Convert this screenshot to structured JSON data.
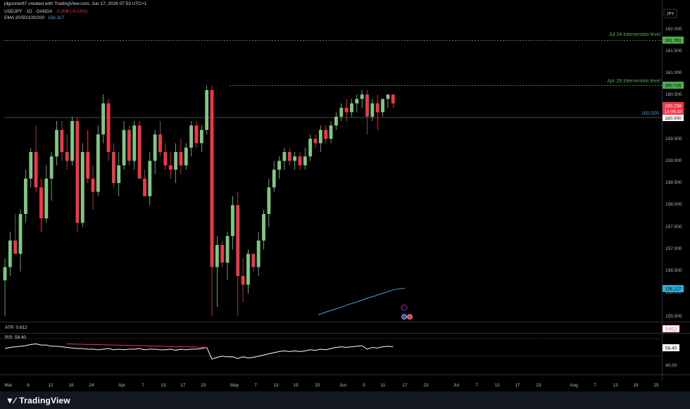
{
  "header": {
    "credit": "jdgunner87 created with TradingView.com, Jun 17, 2026 07:53 UTC+1",
    "symbol_line": "USDJPY · 1D · OANDA",
    "change": "-0.208 (-0.13%)",
    "ema_label": "EMA 20/50/100/200",
    "ema_value": "156.117"
  },
  "currency": "JPY",
  "price_axis": {
    "ticks": [
      "162.000",
      "161.500",
      "161.000",
      "160.500",
      "159.500",
      "159.000",
      "158.500",
      "158.000",
      "157.500",
      "157.000",
      "156.500",
      "156.000",
      "155.500"
    ]
  },
  "levels": {
    "jul24": {
      "label": "Jul 24 Intervention level",
      "value": "161.761"
    },
    "apr26": {
      "label": "Apr 26 Intervention level",
      "value": "160.726"
    },
    "round": {
      "label": "160.000",
      "value": "160.000"
    },
    "last": {
      "price": "160.258",
      "countdown": "14:06:33"
    },
    "ema_tag": "156.117"
  },
  "atr": {
    "label": "ATR",
    "value": "0.612",
    "tag": "0.612"
  },
  "rsi": {
    "label": "RSI",
    "value": "58.40",
    "tag": "58.40",
    "tick_low": "40.00"
  },
  "x_axis": {
    "labels": [
      "Mar",
      "6",
      "12",
      "18",
      "24",
      "Apr",
      "7",
      "13",
      "17",
      "23",
      "May",
      "7",
      "13",
      "19",
      "25",
      "Jun",
      "5",
      "11",
      "17",
      "23",
      "Jul",
      "7",
      "13",
      "17",
      "23",
      "Aug",
      "7",
      "13",
      "19",
      "25"
    ]
  },
  "footer": {
    "brand": "TradingView"
  },
  "colors": {
    "up": "#81c784",
    "down": "#f23645",
    "ema": "#2ab1d9",
    "level": "#4caf50"
  },
  "chart_data": {
    "type": "candlestick",
    "ylim": [
      155.35,
      162.3
    ],
    "candles": [
      [
        156.3,
        156.8,
        155.5,
        156.6
      ],
      [
        156.6,
        157.4,
        156.4,
        157.2
      ],
      [
        157.2,
        157.8,
        156.9,
        156.9
      ],
      [
        156.9,
        157.9,
        156.5,
        157.8
      ],
      [
        157.8,
        158.8,
        157.6,
        158.6
      ],
      [
        158.6,
        159.3,
        158.4,
        159.2
      ],
      [
        159.2,
        159.8,
        158.3,
        158.4
      ],
      [
        158.4,
        158.6,
        157.4,
        157.7
      ],
      [
        157.7,
        158.9,
        157.6,
        158.6
      ],
      [
        158.6,
        159.2,
        158.1,
        159.1
      ],
      [
        159.1,
        159.9,
        158.9,
        159.7
      ],
      [
        159.7,
        159.9,
        159.0,
        159.2
      ],
      [
        159.2,
        159.6,
        158.8,
        159.0
      ],
      [
        159.0,
        160.0,
        158.9,
        159.9
      ],
      [
        159.9,
        160.0,
        157.4,
        157.6
      ],
      [
        157.6,
        159.4,
        157.5,
        159.2
      ],
      [
        159.2,
        159.7,
        158.5,
        158.6
      ],
      [
        158.6,
        158.9,
        157.9,
        158.3
      ],
      [
        158.3,
        159.8,
        158.2,
        159.6
      ],
      [
        159.6,
        160.5,
        159.4,
        160.3
      ],
      [
        160.3,
        160.4,
        159.0,
        159.2
      ],
      [
        159.2,
        159.4,
        158.4,
        158.5
      ],
      [
        158.5,
        159.2,
        158.2,
        158.9
      ],
      [
        158.9,
        159.9,
        158.8,
        159.7
      ],
      [
        159.7,
        159.8,
        158.9,
        159.0
      ],
      [
        159.0,
        159.9,
        158.8,
        159.8
      ],
      [
        159.8,
        159.9,
        158.8,
        158.6
      ],
      [
        158.6,
        158.8,
        158.2,
        158.2
      ],
      [
        158.2,
        159.2,
        158.0,
        159.0
      ],
      [
        159.0,
        159.7,
        158.7,
        159.6
      ],
      [
        159.6,
        159.9,
        159.1,
        159.2
      ],
      [
        159.2,
        159.4,
        158.8,
        158.9
      ],
      [
        158.9,
        159.2,
        158.6,
        158.8
      ],
      [
        158.8,
        159.4,
        158.5,
        159.2
      ],
      [
        159.2,
        159.5,
        158.7,
        158.9
      ],
      [
        158.9,
        159.4,
        158.8,
        159.3
      ],
      [
        159.3,
        159.9,
        159.1,
        159.8
      ],
      [
        159.8,
        159.9,
        159.3,
        159.4
      ],
      [
        159.4,
        159.8,
        159.2,
        159.7
      ],
      [
        159.7,
        160.7,
        159.6,
        160.6
      ],
      [
        160.6,
        160.7,
        155.5,
        156.6
      ],
      [
        156.6,
        157.3,
        155.7,
        157.1
      ],
      [
        157.1,
        157.2,
        156.6,
        156.7
      ],
      [
        156.7,
        157.4,
        156.3,
        157.3
      ],
      [
        157.3,
        158.2,
        157.0,
        158.0
      ],
      [
        158.0,
        158.3,
        155.5,
        156.4
      ],
      [
        156.4,
        156.8,
        155.8,
        156.2
      ],
      [
        156.2,
        157.0,
        156.0,
        156.9
      ],
      [
        156.9,
        156.9,
        156.5,
        156.6
      ],
      [
        156.6,
        157.4,
        156.4,
        157.2
      ],
      [
        157.2,
        157.9,
        157.0,
        157.8
      ],
      [
        157.8,
        158.6,
        157.5,
        158.4
      ],
      [
        158.4,
        159.0,
        158.3,
        158.8
      ],
      [
        158.8,
        159.1,
        158.6,
        159.0
      ],
      [
        159.0,
        159.3,
        158.8,
        159.2
      ],
      [
        159.2,
        159.3,
        158.9,
        159.0
      ],
      [
        159.0,
        159.2,
        158.8,
        159.1
      ],
      [
        159.1,
        159.2,
        158.8,
        158.9
      ],
      [
        158.9,
        159.3,
        158.8,
        159.1
      ],
      [
        159.1,
        159.6,
        159.0,
        159.5
      ],
      [
        159.5,
        159.6,
        159.3,
        159.4
      ],
      [
        159.4,
        159.8,
        159.2,
        159.7
      ],
      [
        159.7,
        159.8,
        159.4,
        159.5
      ],
      [
        159.5,
        159.9,
        159.4,
        159.8
      ],
      [
        159.8,
        160.1,
        159.7,
        160.0
      ],
      [
        160.0,
        160.3,
        159.9,
        160.2
      ],
      [
        160.2,
        160.4,
        159.9,
        160.1
      ],
      [
        160.1,
        160.4,
        160.0,
        160.3
      ],
      [
        160.3,
        160.5,
        160.1,
        160.4
      ],
      [
        160.4,
        160.6,
        160.2,
        160.5
      ],
      [
        160.5,
        160.6,
        159.6,
        160.0
      ],
      [
        160.0,
        160.4,
        159.9,
        160.3
      ],
      [
        160.3,
        160.5,
        159.7,
        160.1
      ],
      [
        160.1,
        160.4,
        160.0,
        160.4
      ],
      [
        160.4,
        160.5,
        160.2,
        160.5
      ],
      [
        160.5,
        160.5,
        160.2,
        160.3
      ]
    ],
    "ema_200": [
      155.52,
      155.57,
      155.62,
      155.66,
      155.71,
      155.76,
      155.8,
      155.85,
      155.9,
      155.94,
      155.99,
      156.03,
      156.08,
      156.11,
      156.12
    ],
    "atr_value": 0.612,
    "rsi": [
      53,
      55,
      56,
      57,
      58,
      60,
      61,
      59,
      59,
      57,
      57,
      56,
      55,
      54,
      53,
      53,
      52,
      52,
      51,
      52,
      53,
      51,
      52,
      51,
      52,
      52,
      53,
      51,
      52,
      52,
      51,
      51,
      52,
      50,
      52,
      51,
      52,
      52,
      53,
      55,
      35,
      38,
      40,
      39,
      39,
      36,
      39,
      37,
      38,
      40,
      42,
      44,
      46,
      48,
      49,
      48,
      49,
      48,
      49,
      51,
      50,
      52,
      51,
      53,
      55,
      56,
      55,
      56,
      57,
      58,
      52,
      55,
      54,
      56,
      57,
      56
    ],
    "rsi_divergence": [
      [
        12,
        61
      ],
      [
        39,
        55
      ]
    ]
  }
}
